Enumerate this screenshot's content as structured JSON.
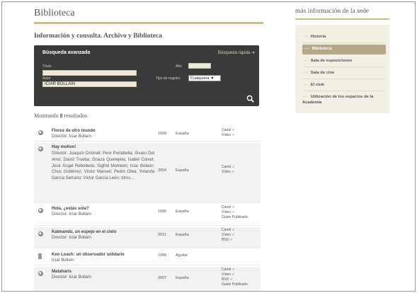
{
  "page": {
    "title": "Biblioteca",
    "subtitle": "Información y consulta. Archivo y Biblioteca"
  },
  "search": {
    "heading": "Búsqueda avanzada",
    "quick_link": "Búsqueda rápida",
    "labels": {
      "title": "Título",
      "author": "Autor",
      "year": "Año",
      "type": "Tipo de registro"
    },
    "values": {
      "title": "",
      "author": "ICIAR BOLLAIN",
      "year": "",
      "type": "Cualquiera"
    },
    "search_icon": "search-icon"
  },
  "results": {
    "showing": "Mostrando",
    "count": "8",
    "suffix": "resultados",
    "items": [
      {
        "icon": "disc-icon",
        "title": "Flores de otro mundo",
        "director": "Director: Icíar Bollaín",
        "year": "1999",
        "country": "España",
        "tags": [
          "Cartel ✓",
          "Vídeo ✓"
        ]
      },
      {
        "icon": "disc-icon",
        "title": "Hay motivo!",
        "director": "Director: Joaquín Oristrell; Pere Portabella; Álvaro Del Amo; David Trueba; Gracia Querejeta; Isabel Coixet; José Ángel Rebolledo; Sigfrid Monleón; Icíar Bollaín; Chus Gutiérrez; Víctor Manuel; Pedro Olea; Yolanda García Serrano; Víctor García León; otros…",
        "year": "2004",
        "country": "España",
        "tags": [
          "Cartel ✓",
          "Vídeo ✓"
        ]
      },
      {
        "icon": "disc-icon",
        "title": "Hola, ¿estás sola?",
        "director": "Director: Icíar Bollaín",
        "year": "1995",
        "country": "España",
        "tags": [
          "Cartel ✓",
          "Vídeo ✓",
          "Guion Publicado"
        ]
      },
      {
        "icon": "disc-icon",
        "title": "Katmandú, un espejo en el cielo",
        "director": "Director: Icíar Bollaín",
        "year": "2011",
        "country": "España",
        "tags": [
          "Cartel ✓",
          "Vídeo ✓",
          "BSO ✓"
        ]
      },
      {
        "icon": "book-icon",
        "title": "Ken Loach: un observador solidario",
        "director": "Icíar Bollaín",
        "year": "1996",
        "country": "Aguilar",
        "tags": []
      },
      {
        "icon": "disc-icon",
        "title": "Mataharis",
        "director": "Director: Icíar Bollaín",
        "year": "2007",
        "country": "España",
        "tags": [
          "Cartel ✓",
          "Vídeo ✓",
          "BSO ✓",
          "Guion Publicado"
        ]
      }
    ]
  },
  "sidebar": {
    "title": "más información de la sede",
    "items": [
      {
        "label": "Historia",
        "active": false
      },
      {
        "label": "Biblioteca",
        "active": true
      },
      {
        "label": "Sala de exposiciones",
        "active": false
      },
      {
        "label": "Sala de cine",
        "active": false
      },
      {
        "label": "El club",
        "active": false
      },
      {
        "label": "Utilización de los espacios de la Academia",
        "active": false
      }
    ]
  },
  "colors": {
    "accent": "#c9bd8c",
    "search_panel": "#3a3a38",
    "sidebar_bg": "#f2efe4",
    "active_item": "#b6a98a"
  }
}
